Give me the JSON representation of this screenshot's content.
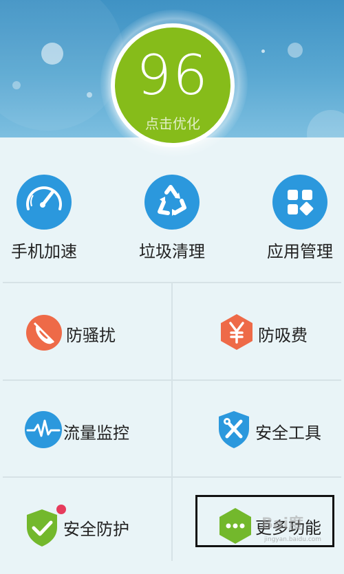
{
  "score": {
    "value": "96",
    "label": "点击优化"
  },
  "shortcuts": [
    {
      "label": "手机加速",
      "icon": "speedometer-icon"
    },
    {
      "label": "垃圾清理",
      "icon": "recycle-icon"
    },
    {
      "label": "应用管理",
      "icon": "apps-grid-icon"
    }
  ],
  "features": [
    {
      "label": "防骚扰",
      "icon": "block-call-icon"
    },
    {
      "label": "防吸费",
      "icon": "yen-shield-icon"
    },
    {
      "label": "流量监控",
      "icon": "traffic-wave-icon"
    },
    {
      "label": "安全工具",
      "icon": "tools-shield-icon"
    },
    {
      "label": "安全防护",
      "icon": "check-shield-icon"
    },
    {
      "label": "更多功能",
      "icon": "more-dots-icon"
    }
  ],
  "watermark": {
    "text": "Bai度",
    "sub": "jingyan.baidu.com"
  },
  "colors": {
    "accent_blue": "#2b98dd",
    "score_green": "#86bc1a",
    "orange": "#ee6a48",
    "green": "#73b82c",
    "badge": "#e63b5c"
  }
}
